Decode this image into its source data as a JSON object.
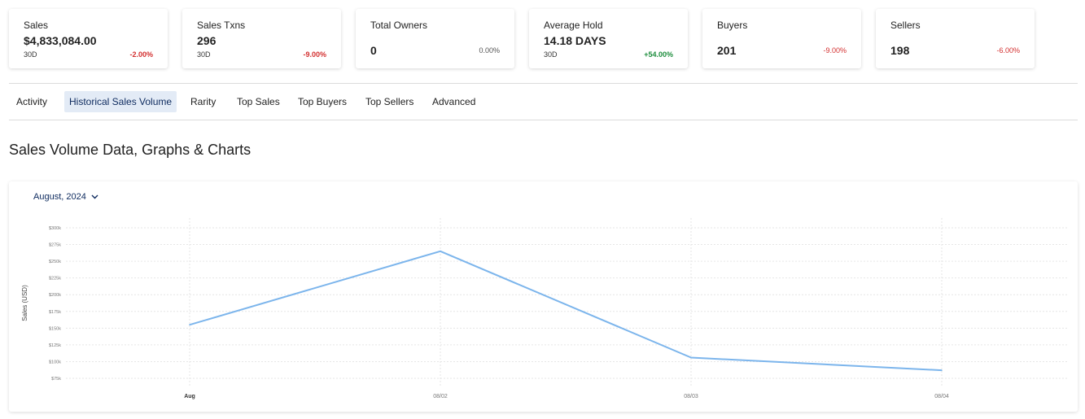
{
  "stats": [
    {
      "title": "Sales",
      "value": "$4,833,084.00",
      "period": "30D",
      "change": "-2.00%",
      "trend": "neg"
    },
    {
      "title": "Sales Txns",
      "value": "296",
      "period": "30D",
      "change": "-9.00%",
      "trend": "neg"
    },
    {
      "title": "Total Owners",
      "value": "0",
      "period": "",
      "change": "0.00%",
      "trend": "neu"
    },
    {
      "title": "Average Hold",
      "value": "14.18 DAYS",
      "period": "30D",
      "change": "+54.00%",
      "trend": "pos"
    },
    {
      "title": "Buyers",
      "value": "201",
      "period": "",
      "change": "-9.00%",
      "trend": "neg"
    },
    {
      "title": "Sellers",
      "value": "198",
      "period": "",
      "change": "-6.00%",
      "trend": "neg"
    }
  ],
  "tabs": [
    {
      "label": "Activity",
      "active": false
    },
    {
      "label": "Historical Sales Volume",
      "active": true
    },
    {
      "label": "Rarity",
      "active": false
    },
    {
      "label": "Top Sales",
      "active": false
    },
    {
      "label": "Top Buyers",
      "active": false
    },
    {
      "label": "Top Sellers",
      "active": false
    },
    {
      "label": "Advanced",
      "active": false
    }
  ],
  "section_title": "Sales Volume Data, Graphs & Charts",
  "month_select": {
    "label": "August, 2024",
    "icon": "chevron-down-icon"
  },
  "colors": {
    "line": "#7cb5ec",
    "accent": "#0d2a5e",
    "negative": "#d32f2f",
    "positive": "#1e8e3e"
  },
  "chart_data": {
    "type": "line",
    "categories": [
      "Aug",
      "08/02",
      "08/03",
      "08/04"
    ],
    "series": [
      {
        "values": [
          155000,
          265000,
          106000,
          87000
        ]
      }
    ],
    "ylabel": "Sales (USD)",
    "yticks": [
      "$75k",
      "$100k",
      "$125k",
      "$150k",
      "$175k",
      "$200k",
      "$225k",
      "$250k",
      "$275k",
      "$300k"
    ],
    "ytick_values": [
      75000,
      100000,
      125000,
      150000,
      175000,
      200000,
      225000,
      250000,
      275000,
      300000
    ],
    "ylim": [
      75000,
      300000
    ],
    "grid": true
  }
}
